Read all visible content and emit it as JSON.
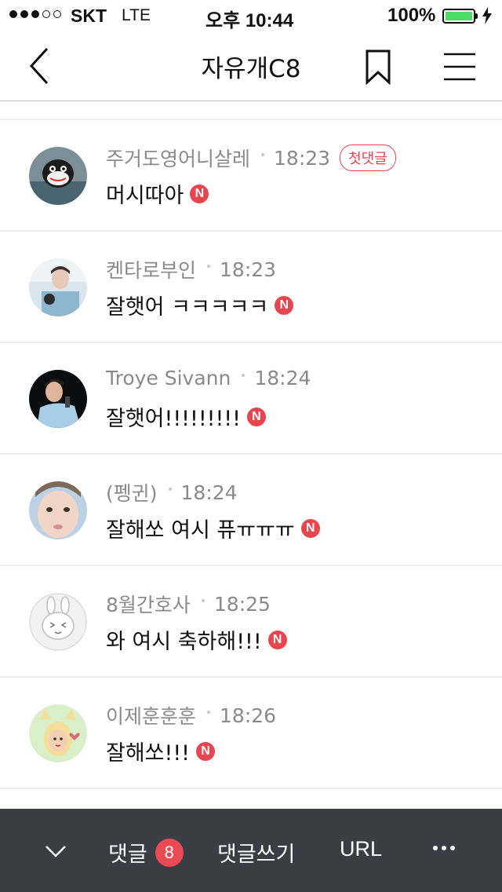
{
  "status_bar": {
    "carrier": "SKT",
    "network": "LTE",
    "time": "오후 10:44",
    "battery_percent": "100%",
    "battery_level": 1.0,
    "signal_bars_filled": 3,
    "signal_bars_total": 5
  },
  "nav": {
    "title": "자유개C8",
    "back_icon": "chevron-left-icon",
    "bookmark_icon": "bookmark-icon",
    "menu_icon": "hamburger-menu-icon"
  },
  "comments": [
    {
      "author": "주거도영어니살레",
      "time": "18:23",
      "badge": "첫댓글",
      "text": "머시따아",
      "new": "N"
    },
    {
      "author": "켄타로부인",
      "time": "18:23",
      "badge": "",
      "text": "잘햇어 ㅋㅋㅋㅋㅋ",
      "new": "N"
    },
    {
      "author": "Troye Sivann",
      "time": "18:24",
      "badge": "",
      "text": "잘햇어!!!!!!!!!",
      "new": "N"
    },
    {
      "author": "(펭귄)",
      "time": "18:24",
      "badge": "",
      "text": "잘해쏘 여시 퓨ㅠㅠㅠ",
      "new": "N"
    },
    {
      "author": "8월간호사",
      "time": "18:25",
      "badge": "",
      "text": "와 여시 축하해!!!",
      "new": "N"
    },
    {
      "author": "이제훈훈훈",
      "time": "18:26",
      "badge": "",
      "text": "잘해쏘!!!",
      "new": "N"
    }
  ],
  "bottom_bar": {
    "comments_label": "댓글",
    "comments_count": "8",
    "write_label": "댓글쓰기",
    "url_label": "URL"
  },
  "colors": {
    "accent": "#e8454f",
    "bottom_bar_bg": "#3a3d44",
    "battery_green": "#4cd964"
  }
}
